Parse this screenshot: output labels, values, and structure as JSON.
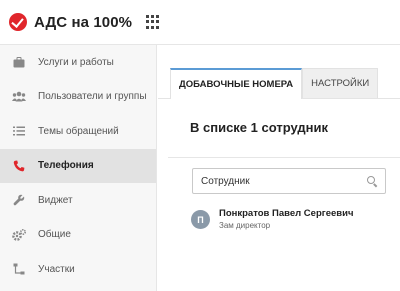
{
  "header": {
    "brand": "АДС на 100%",
    "logo_icon": "check-circle-icon",
    "apps_icon": "grid-icon",
    "brand_color": "#e0262b"
  },
  "sidebar": {
    "items": [
      {
        "label": "Услуги и работы",
        "icon": "briefcase-icon"
      },
      {
        "label": "Пользователи и группы",
        "icon": "users-icon"
      },
      {
        "label": "Темы обращений",
        "icon": "list-icon"
      },
      {
        "label": "Телефония",
        "icon": "phone-icon",
        "active": true
      },
      {
        "label": "Виджет",
        "icon": "wrench-icon"
      },
      {
        "label": "Общие",
        "icon": "gears-icon"
      },
      {
        "label": "Участки",
        "icon": "sitemap-icon"
      }
    ]
  },
  "main": {
    "tabs": [
      {
        "label": "ДОБАВОЧНЫЕ НОМЕРА",
        "active": true
      },
      {
        "label": "НАСТРОЙКИ",
        "active": false
      }
    ],
    "employees_count": "В списке 1 сотрудник",
    "search": {
      "placeholder": "Сотрудник",
      "value": ""
    },
    "employees": [
      {
        "initial": "П",
        "name": "Понкратов Павел Сергеевич",
        "role": "Зам директор"
      }
    ]
  }
}
